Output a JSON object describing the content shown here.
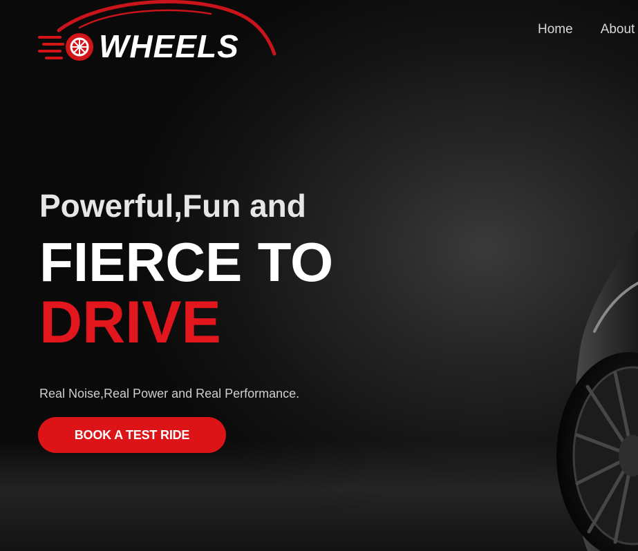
{
  "brand": {
    "name": "WHEELS",
    "accent_color": "#e2171d"
  },
  "nav": {
    "items": [
      {
        "label": "Home"
      },
      {
        "label": "About"
      }
    ]
  },
  "hero": {
    "subtitle": "Powerful,Fun and",
    "title": "FIERCE TO",
    "accent": "DRIVE",
    "tagline": "Real Noise,Real Power and Real Performance.",
    "cta_label": "BOOK A TEST RIDE"
  },
  "icons": {
    "logo": "car-wheel-logo-icon",
    "hero_image": "car-icon"
  }
}
